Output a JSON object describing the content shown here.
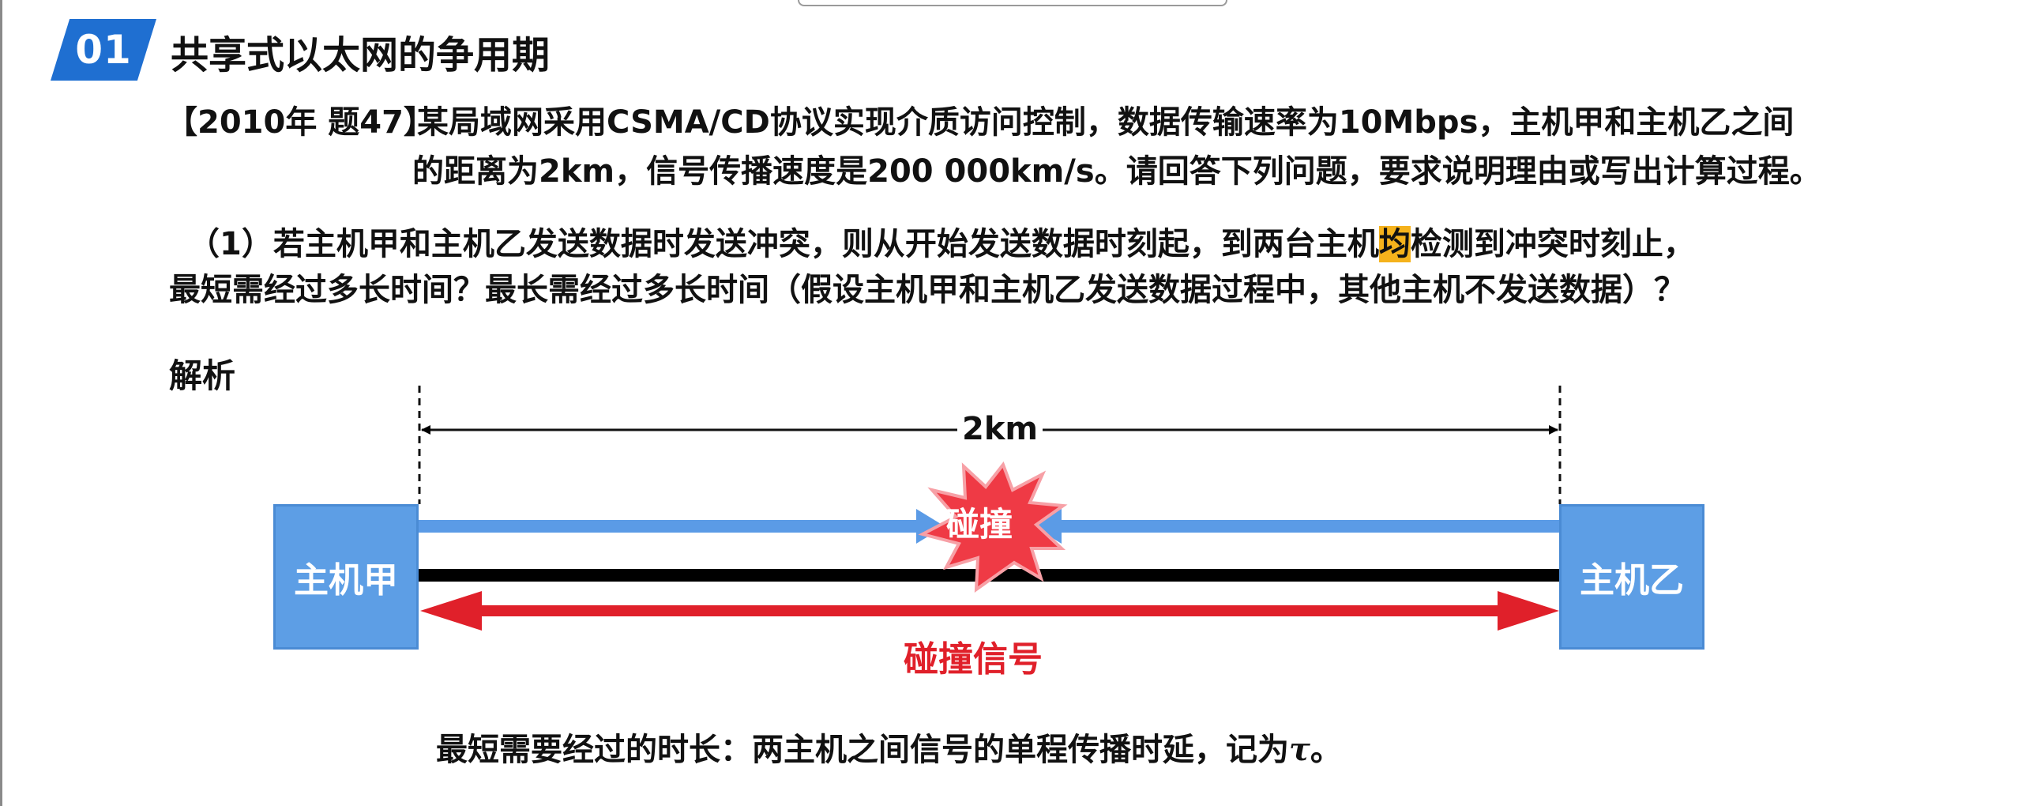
{
  "header": {
    "section_number": "01",
    "section_title": "共享式以太网的争用期"
  },
  "question": {
    "tag": "【2010年 题47】",
    "line1": "某局域网采用CSMA/CD协议实现介质访问控制，数据传输速率为10Mbps，主机甲和主机乙之间",
    "line2": "的距离为2km，信号传播速度是200 000km/s。请回答下列问题，要求说明理由或写出计算过程。"
  },
  "subquestion": {
    "part1_before": "（1）若主机甲和主机乙发送数据时发送冲突，则从开始发送数据时刻起，到两台主机",
    "part1_highlight": "均",
    "part1_after": "检测到冲突时刻止，",
    "part2": "最短需经过多长时间？最长需经过多长时间（假设主机甲和主机乙发送数据过程中，其他主机不发送数据）？"
  },
  "analysis": {
    "label": "解析"
  },
  "diagram": {
    "host_a": "主机甲",
    "host_b": "主机乙",
    "distance": "2km",
    "collision": "碰撞",
    "collision_signal": "碰撞信号",
    "colors": {
      "host_fill": "#5d9ee5",
      "signal_line": "#5b9be6",
      "bus_line": "#000000",
      "collision_arrow": "#e0202a",
      "burst_fill": "#ef3a45"
    }
  },
  "conclusion": {
    "text": "最短需要经过的时长：两主机之间信号的单程传播时延，记为",
    "symbol": "τ",
    "end": "。"
  },
  "accent_color": "#1f6fd1",
  "highlight_color": "#f5b21c"
}
